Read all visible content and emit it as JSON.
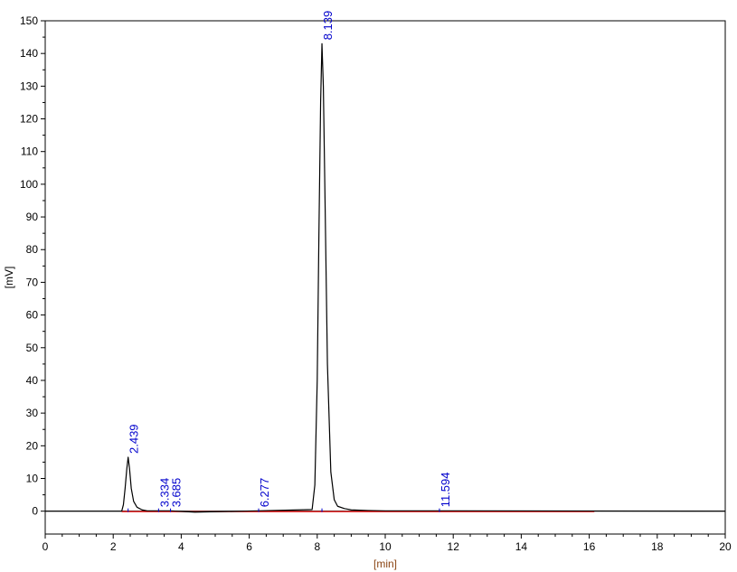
{
  "chart_data": {
    "type": "line",
    "title": "",
    "xlabel": "[min]",
    "ylabel": "[mV]",
    "xlim": [
      0,
      20
    ],
    "ylim": [
      -7,
      150
    ],
    "x_ticks": [
      0,
      2,
      4,
      6,
      8,
      10,
      12,
      14,
      16,
      18,
      20
    ],
    "y_ticks": [
      0,
      10,
      20,
      30,
      40,
      50,
      60,
      70,
      80,
      90,
      100,
      110,
      120,
      130,
      140,
      150
    ],
    "grid": false,
    "series": [
      {
        "color": "#000000",
        "x": [
          0,
          2.25,
          2.3,
          2.35,
          2.4,
          2.439,
          2.48,
          2.53,
          2.6,
          2.7,
          2.85,
          3.0,
          3.334,
          3.685,
          4.4,
          6.277,
          7.85,
          7.93,
          8.0,
          8.05,
          8.1,
          8.139,
          8.18,
          8.23,
          8.3,
          8.4,
          8.5,
          8.6,
          8.8,
          9.0,
          9.5,
          10.0,
          11.594,
          20
        ],
        "y": [
          0,
          0,
          2,
          7,
          13,
          16.5,
          13,
          7,
          3,
          1.2,
          0.4,
          0.1,
          0.1,
          0.1,
          -0.3,
          0.1,
          0.5,
          8,
          40,
          85,
          125,
          143,
          130,
          95,
          45,
          12,
          3.5,
          1.5,
          0.8,
          0.4,
          0.2,
          0.1,
          0.1,
          0
        ]
      }
    ],
    "baseline": {
      "color": "#ff0000",
      "x": [
        2.25,
        16.15
      ]
    },
    "peaks": [
      {
        "label": "2.439",
        "x": 2.439
      },
      {
        "label": "3.334",
        "x": 3.334
      },
      {
        "label": "3.685",
        "x": 3.685
      },
      {
        "label": "6.277",
        "x": 6.277
      },
      {
        "label": "8.139",
        "x": 8.139
      },
      {
        "label": "11.594",
        "x": 11.594
      }
    ],
    "colors": {
      "trace": "#000000",
      "baseline": "#ff0000",
      "peak_label": "#0000cc",
      "xlabel": "#8b4513"
    }
  }
}
